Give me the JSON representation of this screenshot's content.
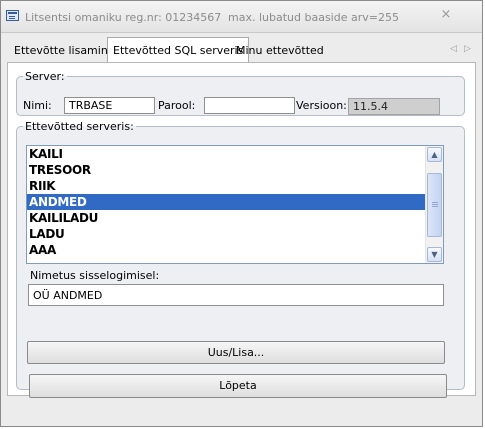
{
  "window": {
    "title_left": "Litsentsi omaniku reg.nr: 01234567",
    "title_right": "max. lubatud baaside arv=255",
    "close_glyph": "×"
  },
  "tabs": [
    {
      "label": "Ettevõtte lisamine",
      "active": false
    },
    {
      "label": "Ettevõtted SQL serveris",
      "active": true
    },
    {
      "label": "Minu ettevõtted",
      "active": false
    }
  ],
  "tab_nav": {
    "prev": "◁",
    "next": "▷"
  },
  "server": {
    "legend": "Server:",
    "name_label": "Nimi:",
    "name_value": "TRBASE",
    "password_label": "Parool:",
    "password_value": "",
    "version_label": "Versioon:",
    "version_value": "11.5.4"
  },
  "companies": {
    "legend": "Ettevõtted serveris:",
    "items": [
      {
        "label": "KAILI",
        "selected": false
      },
      {
        "label": "TRESOOR",
        "selected": false
      },
      {
        "label": "RIIK",
        "selected": false
      },
      {
        "label": "ANDMED",
        "selected": true
      },
      {
        "label": "KAILILADU",
        "selected": false
      },
      {
        "label": "LADU",
        "selected": false
      },
      {
        "label": "AAA",
        "selected": false
      }
    ],
    "login_name_label": "Nimetus sisselogimisel:",
    "login_name_value": "OÜ ANDMED",
    "new_add_button": "Uus/Lisa..."
  },
  "finish_button": "Lõpeta",
  "colors": {
    "selection": "#316ac5",
    "window_bg": "#ececec",
    "group_border": "#b3bcc7"
  },
  "icons": [
    "app-icon",
    "close-icon",
    "scroll-up-icon",
    "scroll-down-icon",
    "tab-prev-icon",
    "tab-next-icon"
  ]
}
